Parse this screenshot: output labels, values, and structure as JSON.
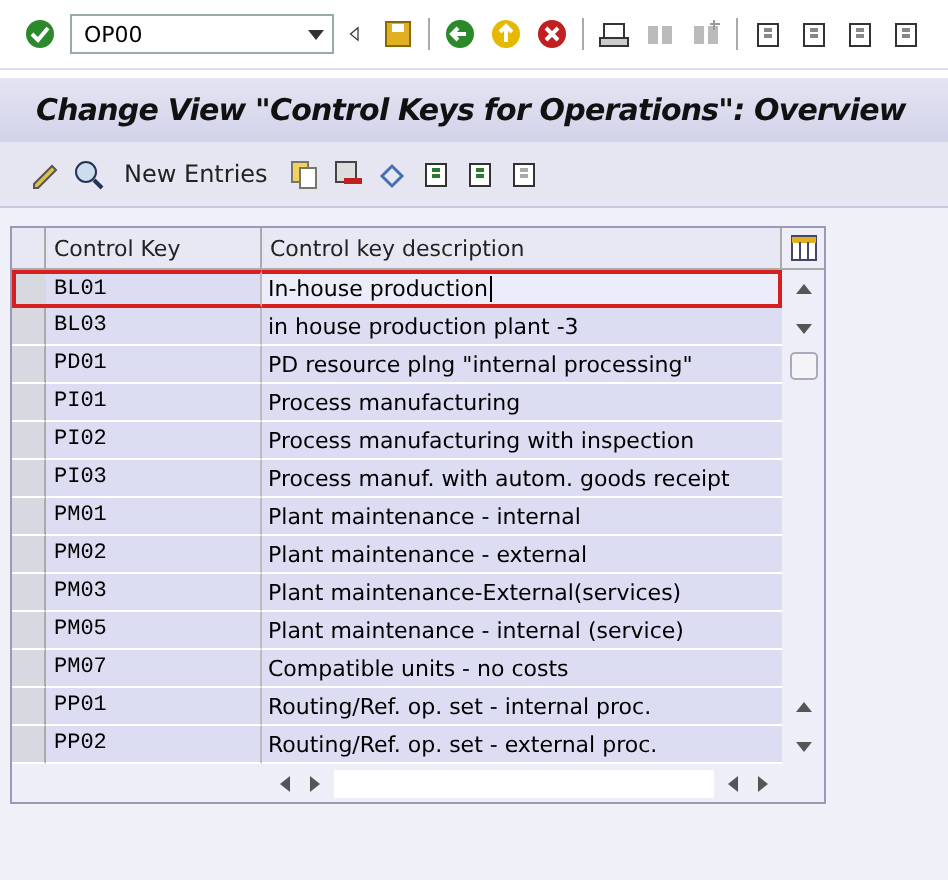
{
  "command_field": {
    "value": "OP00"
  },
  "title": "Change View \"Control Keys for Operations\": Overview",
  "app_toolbar": {
    "new_entries": "New Entries"
  },
  "table": {
    "columns": [
      "Control Key",
      "Control key description"
    ],
    "rows": [
      {
        "key": "BL01",
        "description": "In-house production",
        "selected": true
      },
      {
        "key": "BL03",
        "description": "in house production plant -3",
        "selected": false
      },
      {
        "key": "PD01",
        "description": "PD resource plng \"internal processing\"",
        "selected": false
      },
      {
        "key": "PI01",
        "description": "Process manufacturing",
        "selected": false
      },
      {
        "key": "PI02",
        "description": "Process manufacturing with inspection",
        "selected": false
      },
      {
        "key": "PI03",
        "description": "Process manuf. with autom. goods receipt",
        "selected": false
      },
      {
        "key": "PM01",
        "description": "Plant maintenance - internal",
        "selected": false
      },
      {
        "key": "PM02",
        "description": "Plant maintenance - external",
        "selected": false
      },
      {
        "key": "PM03",
        "description": "Plant maintenance-External(services)",
        "selected": false
      },
      {
        "key": "PM05",
        "description": "Plant maintenance - internal (service)",
        "selected": false
      },
      {
        "key": "PM07",
        "description": "Compatible units - no costs",
        "selected": false
      },
      {
        "key": "PP01",
        "description": "Routing/Ref. op. set - internal proc.",
        "selected": false
      },
      {
        "key": "PP02",
        "description": "Routing/Ref. op. set - external proc.",
        "selected": false
      }
    ]
  }
}
